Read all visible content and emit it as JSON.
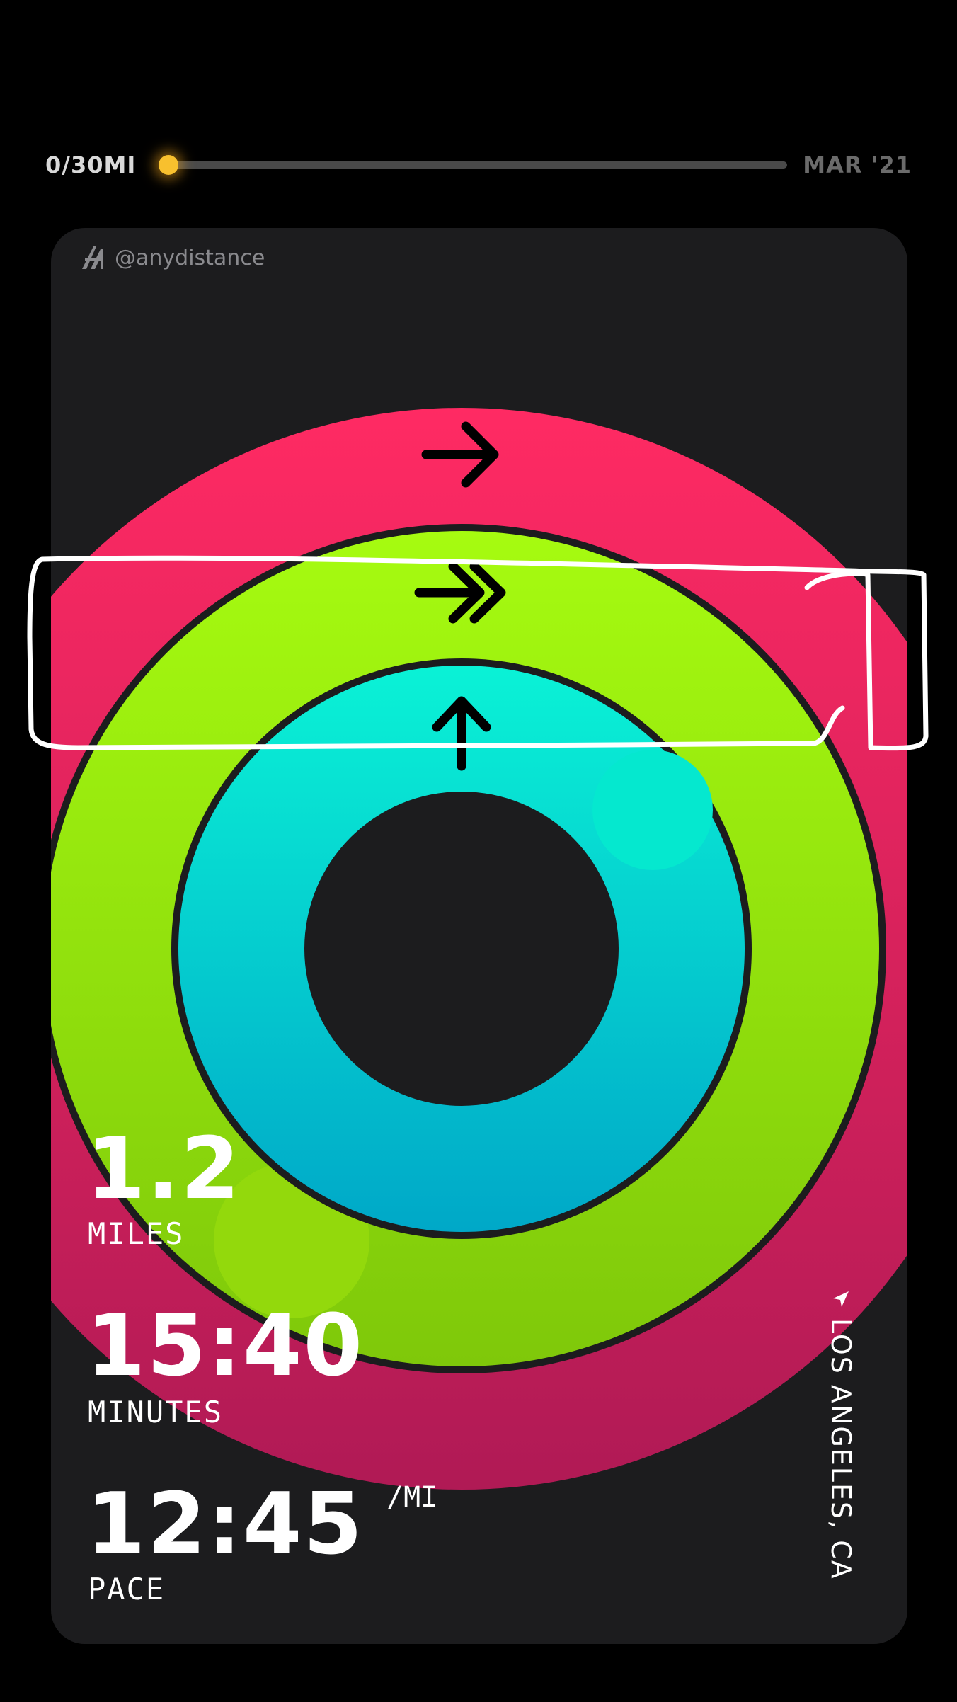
{
  "progress": {
    "label": "0/30MI",
    "date": "MAR '21",
    "fraction": 0
  },
  "card": {
    "brand_handle": "@anydistance",
    "stats": [
      {
        "value": "1.2",
        "label": "MILES"
      },
      {
        "value": "15:40",
        "label": "MINUTES"
      },
      {
        "value": "12:45",
        "label": "PACE",
        "unit": "/MI"
      }
    ],
    "location": "LOS ANGELES, CA"
  },
  "colors": {
    "move_ring": "#fa2465",
    "exercise_ring": "#a4f712",
    "stand_ring": "#00e0d4",
    "progress_knob": "#f8c02e",
    "card_bg": "#1c1c1e"
  },
  "icons": {
    "move": "arrow-right-icon",
    "exercise": "double-arrow-right-icon",
    "stand": "arrow-up-icon",
    "location": "location-arrow-icon"
  }
}
